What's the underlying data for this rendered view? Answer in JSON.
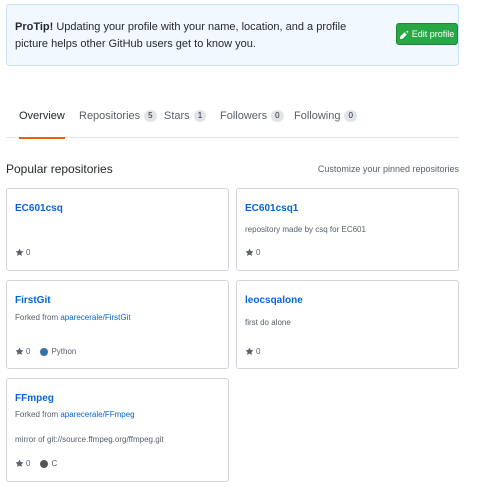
{
  "protip": {
    "bold": "ProTip!",
    "text": " Updating your profile with your name, location, and a profile picture helps other GitHub users get to know you.",
    "button_label": "Edit profile"
  },
  "tabs": [
    {
      "label": "Overview"
    },
    {
      "label": "Repositories",
      "count": "5"
    },
    {
      "label": "Stars",
      "count": "1"
    },
    {
      "label": "Followers",
      "count": "0"
    },
    {
      "label": "Following",
      "count": "0"
    }
  ],
  "section": {
    "title": "Popular repositories",
    "customize": "Customize your pinned repositories"
  },
  "repos": [
    {
      "name": "EC601csq",
      "stars": "0"
    },
    {
      "name": "EC601csq1",
      "description": "repository made by csq for EC601",
      "stars": "0"
    },
    {
      "name": "FirstGit",
      "forked_prefix": "Forked from ",
      "forked_from": "aparecerale/FirstGit",
      "stars": "0",
      "language": "Python",
      "language_color": "#3572A5"
    },
    {
      "name": "leocsqalone",
      "description": "first do alone",
      "stars": "0"
    },
    {
      "name": "FFmpeg",
      "forked_prefix": "Forked from ",
      "forked_from": "aparecerale/FFmpeg",
      "description": "mirror of git://source.ffmpeg.org/ffmpeg.git",
      "stars": "0",
      "language": "C",
      "language_color": "#555555"
    }
  ],
  "colors": {
    "accent": "#0366d6",
    "tab_underline": "#e36209",
    "button_green": "#28a745"
  }
}
